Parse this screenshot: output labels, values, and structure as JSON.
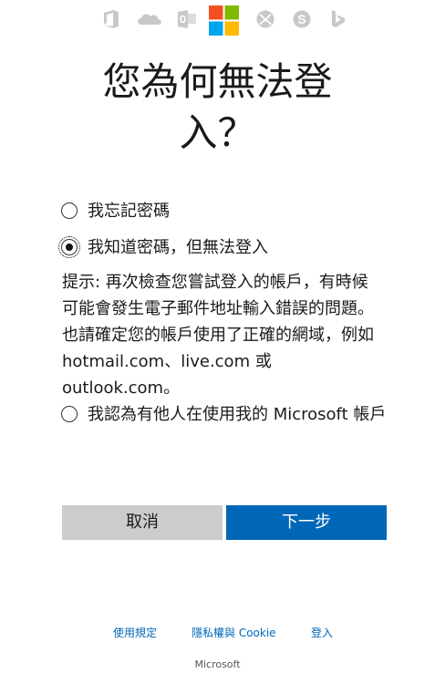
{
  "product_icons": [
    "office-icon",
    "onedrive-icon",
    "outlook-icon",
    "microsoft-logo",
    "xbox-icon",
    "skype-icon",
    "bing-icon"
  ],
  "title_lines": [
    "您為何無法登",
    "入？"
  ],
  "options": [
    {
      "label": "我忘記密碼",
      "selected": false
    },
    {
      "label": "我知道密碼，但無法登入",
      "selected": true
    },
    {
      "label": "我認為有他人在使用我的 Microsoft 帳戶",
      "selected": false
    }
  ],
  "hint": "提示: 再次檢查您嘗試登入的帳戶，有時候可能會發生電子郵件地址輸入錯誤的問題。也請確定您的帳戶使用了正確的網域，例如 hotmail.com、live.com 或 outlook.com。",
  "buttons": {
    "cancel": "取消",
    "next": "下一步"
  },
  "footer": {
    "terms": "使用規定",
    "privacy": "隱私權與 Cookie",
    "signin": "登入",
    "brand": "Microsoft"
  },
  "colors": {
    "accent": "#0067b8",
    "icon_gray": "#c8c8c8",
    "cancel_bg": "#cccccc",
    "logo_red": "#f25022",
    "logo_green": "#7fba00",
    "logo_blue": "#00a4ef",
    "logo_yellow": "#ffb900"
  }
}
